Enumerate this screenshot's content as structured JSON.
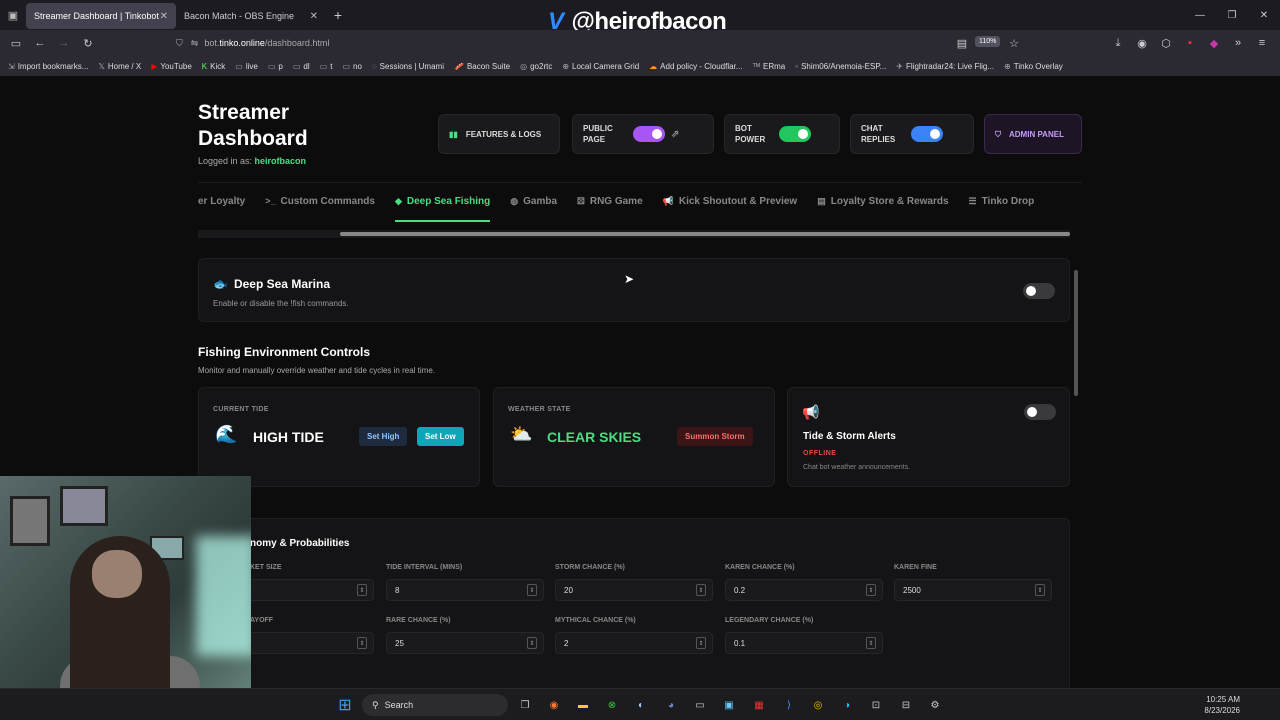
{
  "browser": {
    "tabs": [
      {
        "label": "Streamer Dashboard | Tinkobot",
        "active": true
      },
      {
        "label": "Bacon Match - OBS Engine",
        "active": false
      }
    ],
    "overlay_handle": "@heirofbacon",
    "url_prefix": "bot.",
    "url_host": "tinko.online",
    "url_path": "/dashboard.html",
    "zoom": "110%",
    "bookmarks": [
      "Import bookmarks...",
      "Home / X",
      "YouTube",
      "Kick",
      "live",
      "p",
      "dl",
      "t",
      "no",
      "Sessions | Umami",
      "Bacon Suite",
      "go2rtc",
      "Local Camera Grid",
      "Add policy - Cloudflar...",
      "ERma",
      "Shim06/Anemoia-ESP...",
      "Flightradar24: Live Flig...",
      "Tinko Overlay"
    ]
  },
  "header": {
    "title_line1": "Streamer",
    "title_line2": "Dashboard",
    "logged_in_prefix": "Logged in as: ",
    "username": "heirofbacon",
    "features_label": "FEATURES & LOGS",
    "public_page_label": "PUBLIC PAGE",
    "bot_power_label": "BOT POWER",
    "chat_replies_label": "CHAT REPLIES",
    "admin_label": "ADMIN PANEL"
  },
  "tabs": [
    "er Loyalty",
    "Custom Commands",
    "Deep Sea Fishing",
    "Gamba",
    "RNG Game",
    "Kick Shoutout & Preview",
    "Loyalty Store & Rewards",
    "Tinko Drop"
  ],
  "active_tab": "Deep Sea Fishing",
  "marina": {
    "title": "Deep Sea Marina",
    "description": "Enable or disable the !fish commands.",
    "enabled": false
  },
  "environment": {
    "title": "Fishing Environment Controls",
    "description": "Monitor and manually override weather and tide cycles in real time.",
    "tide_label": "CURRENT TIDE",
    "tide_value": "HIGH TIDE",
    "set_high": "Set High",
    "set_low": "Set Low",
    "weather_label": "WEATHER STATE",
    "weather_value": "CLEAR SKIES",
    "summon_storm": "Summon Storm",
    "alerts_title": "Tide & Storm Alerts",
    "alerts_status": "OFFLINE",
    "alerts_desc": "Chat bot weather announcements."
  },
  "economy": {
    "title": "nomy & Probabilities",
    "fields": [
      {
        "label": "KET SIZE",
        "value": ""
      },
      {
        "label": "TIDE INTERVAL (MINS)",
        "value": "8"
      },
      {
        "label": "STORM CHANCE (%)",
        "value": "20"
      },
      {
        "label": "KAREN CHANCE (%)",
        "value": "0.2"
      },
      {
        "label": "KAREN FINE",
        "value": "2500"
      },
      {
        "label": "AYOFF",
        "value": ""
      },
      {
        "label": "RARE CHANCE (%)",
        "value": "25"
      },
      {
        "label": "MYTHICAL CHANCE (%)",
        "value": "2"
      },
      {
        "label": "LEGENDARY CHANCE (%)",
        "value": "0.1"
      }
    ]
  },
  "taskbar": {
    "search": "Search",
    "time": "10:25 AM",
    "date": "8/23/2026"
  },
  "colors": {
    "accent_green": "#4ade80",
    "purple": "#a855f7",
    "blue": "#3b82f6",
    "offline_red": "#ef4444"
  }
}
